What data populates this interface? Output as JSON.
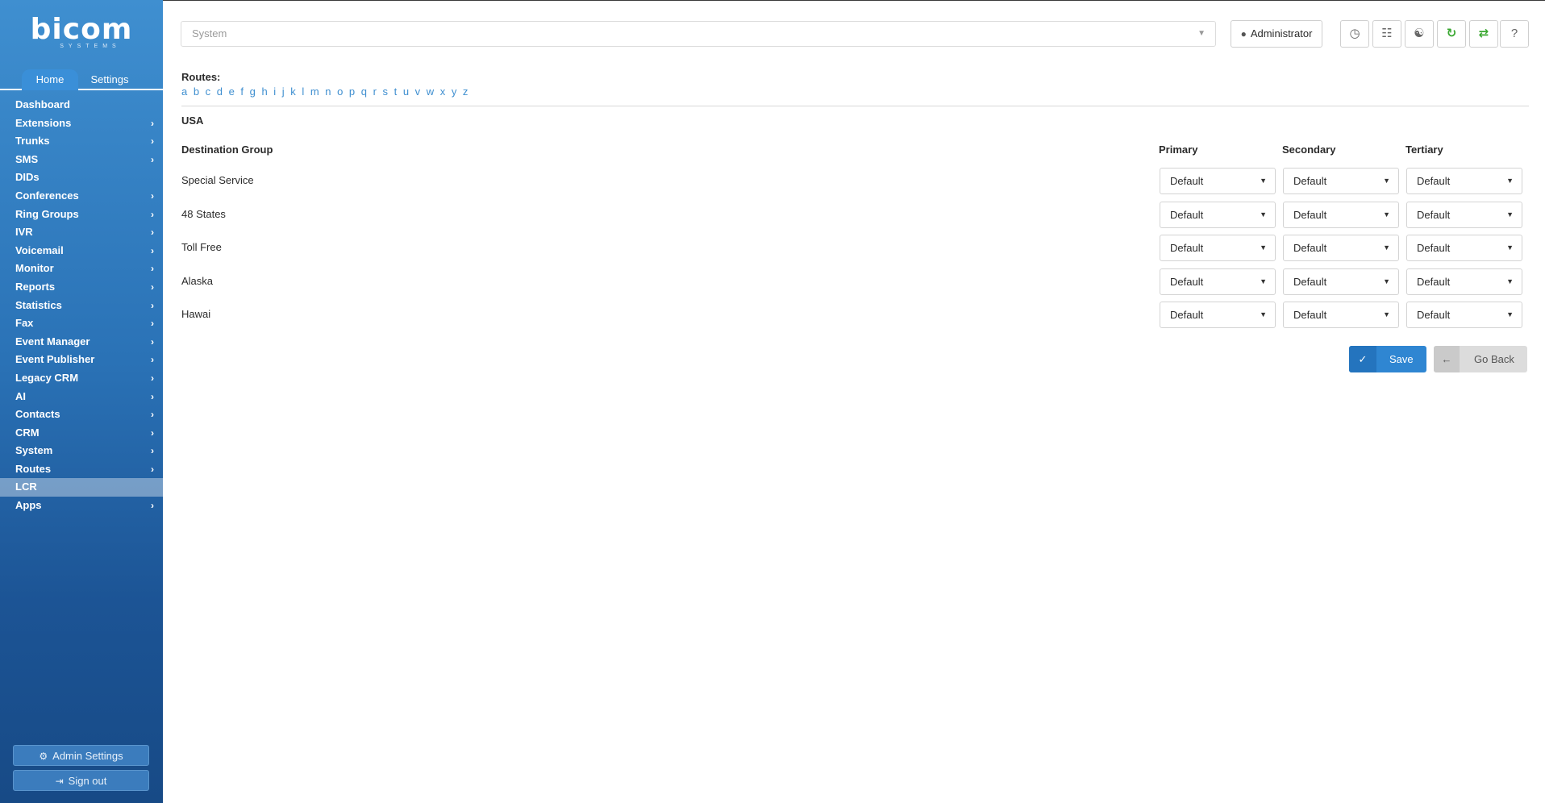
{
  "brand": {
    "name": "bicom",
    "sub": "SYSTEMS"
  },
  "sidebar": {
    "tabs": [
      {
        "label": "Home"
      },
      {
        "label": "Settings"
      }
    ],
    "items": [
      {
        "label": "Dashboard",
        "has_children": false
      },
      {
        "label": "Extensions",
        "has_children": true
      },
      {
        "label": "Trunks",
        "has_children": true
      },
      {
        "label": "SMS",
        "has_children": true
      },
      {
        "label": "DIDs",
        "has_children": false
      },
      {
        "label": "Conferences",
        "has_children": true
      },
      {
        "label": "Ring Groups",
        "has_children": true
      },
      {
        "label": "IVR",
        "has_children": true
      },
      {
        "label": "Voicemail",
        "has_children": true
      },
      {
        "label": "Monitor",
        "has_children": true
      },
      {
        "label": "Reports",
        "has_children": true
      },
      {
        "label": "Statistics",
        "has_children": true
      },
      {
        "label": "Fax",
        "has_children": true
      },
      {
        "label": "Event Manager",
        "has_children": true
      },
      {
        "label": "Event Publisher",
        "has_children": true
      },
      {
        "label": "Legacy CRM",
        "has_children": true
      },
      {
        "label": "AI",
        "has_children": true
      },
      {
        "label": "Contacts",
        "has_children": true
      },
      {
        "label": "CRM",
        "has_children": true
      },
      {
        "label": "System",
        "has_children": true
      },
      {
        "label": "Routes",
        "has_children": true
      },
      {
        "label": "LCR",
        "has_children": false,
        "active": true
      },
      {
        "label": "Apps",
        "has_children": true
      }
    ],
    "admin_settings": "Admin Settings",
    "sign_out": "Sign out"
  },
  "header": {
    "system_placeholder": "System",
    "user": "Administrator",
    "icons": [
      "clock-icon",
      "globe-grid-icon",
      "globe-icon",
      "refresh-icon",
      "sync-icon",
      "help-icon"
    ]
  },
  "content": {
    "routes_label": "Routes:",
    "letters": [
      "a",
      "b",
      "c",
      "d",
      "e",
      "f",
      "g",
      "h",
      "i",
      "j",
      "k",
      "l",
      "m",
      "n",
      "o",
      "p",
      "q",
      "r",
      "s",
      "t",
      "u",
      "v",
      "w",
      "x",
      "y",
      "z"
    ],
    "country": "USA",
    "columns": {
      "group": "Destination Group",
      "primary": "Primary",
      "secondary": "Secondary",
      "tertiary": "Tertiary"
    },
    "rows": [
      {
        "group": "Special Service",
        "primary": "Default",
        "secondary": "Default",
        "tertiary": "Default"
      },
      {
        "group": "48 States",
        "primary": "Default",
        "secondary": "Default",
        "tertiary": "Default"
      },
      {
        "group": "Toll Free",
        "primary": "Default",
        "secondary": "Default",
        "tertiary": "Default"
      },
      {
        "group": "Alaska",
        "primary": "Default",
        "secondary": "Default",
        "tertiary": "Default"
      },
      {
        "group": "Hawai",
        "primary": "Default",
        "secondary": "Default",
        "tertiary": "Default"
      }
    ],
    "save": "Save",
    "go_back": "Go Back"
  },
  "colors": {
    "accent": "#2f86d2",
    "sidebar_top": "#3f8fd0",
    "sidebar_bottom": "#174a86",
    "link": "#3f8fd0",
    "refresh_green": "#3aa831"
  }
}
